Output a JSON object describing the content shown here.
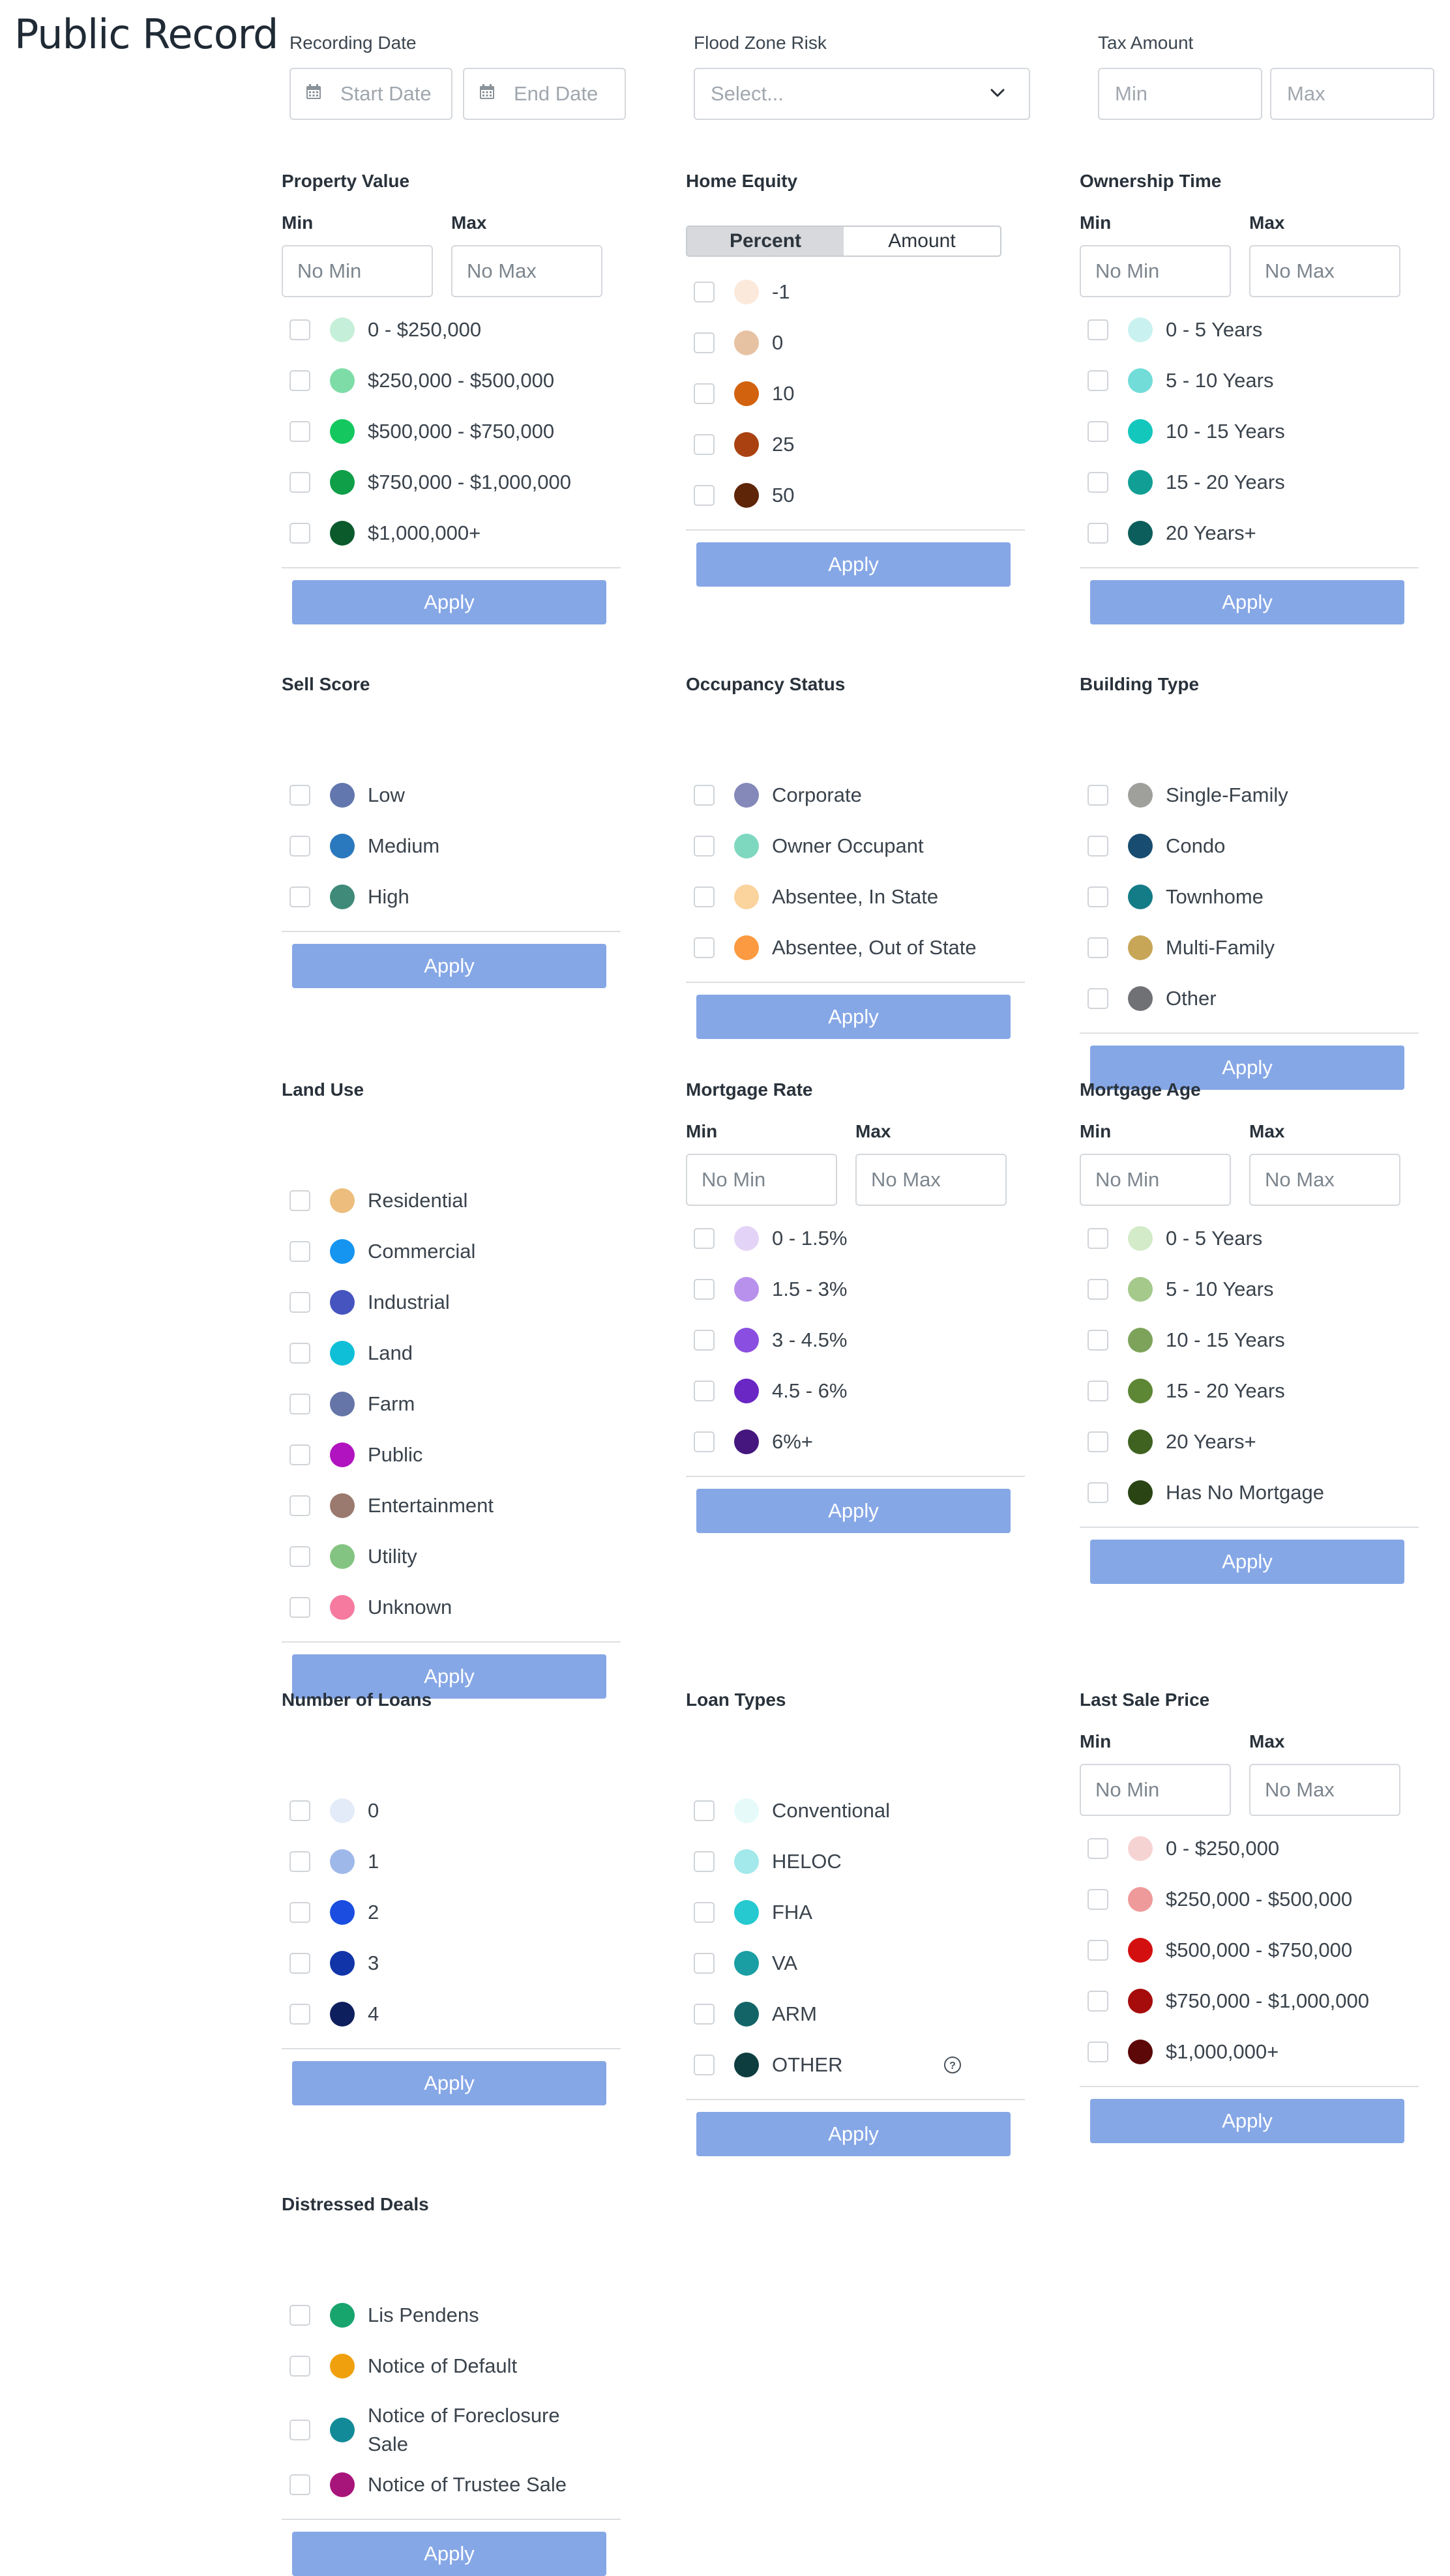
{
  "page": {
    "title": "Public Record"
  },
  "top_filters": {
    "recording_date": {
      "label": "Recording Date",
      "start_placeholder": "Start Date",
      "end_placeholder": "End Date"
    },
    "flood_zone": {
      "label": "Flood Zone Risk",
      "placeholder": "Select..."
    },
    "tax_amount": {
      "label": "Tax Amount",
      "min_placeholder": "Min",
      "max_placeholder": "Max"
    }
  },
  "common": {
    "apply_label": "Apply",
    "min_label": "Min",
    "max_label": "Max",
    "no_min": "No Min",
    "no_max": "No Max"
  },
  "sections": {
    "property_value": {
      "title": "Property Value",
      "options": [
        {
          "label": "0 - $250,000",
          "color": "#c5efd8"
        },
        {
          "label": "$250,000 - $500,000",
          "color": "#7edca6"
        },
        {
          "label": "$500,000 - $750,000",
          "color": "#14c85f"
        },
        {
          "label": "$750,000 - $1,000,000",
          "color": "#0e9f48"
        },
        {
          "label": "$1,000,000+",
          "color": "#0a5a2c"
        }
      ]
    },
    "home_equity": {
      "title": "Home Equity",
      "toggle": {
        "percent": "Percent",
        "amount": "Amount",
        "active": "percent"
      },
      "options": [
        {
          "label": "-1",
          "color": "#fbe9dc"
        },
        {
          "label": "0",
          "color": "#e7c2a2"
        },
        {
          "label": "10",
          "color": "#d2620e"
        },
        {
          "label": "25",
          "color": "#a94210"
        },
        {
          "label": "50",
          "color": "#5e2508"
        }
      ]
    },
    "ownership_time": {
      "title": "Ownership Time",
      "options": [
        {
          "label": "0 - 5 Years",
          "color": "#c9f1f0"
        },
        {
          "label": "5 - 10 Years",
          "color": "#72dcd8"
        },
        {
          "label": "10 - 15 Years",
          "color": "#13c7bd"
        },
        {
          "label": "15 - 20 Years",
          "color": "#119f95"
        },
        {
          "label": "20 Years+",
          "color": "#0b5e5b"
        }
      ]
    },
    "sell_score": {
      "title": "Sell Score",
      "options": [
        {
          "label": "Low",
          "color": "#6277ad"
        },
        {
          "label": "Medium",
          "color": "#2a78bd"
        },
        {
          "label": "High",
          "color": "#3f8a78"
        }
      ]
    },
    "occupancy_status": {
      "title": "Occupancy Status",
      "options": [
        {
          "label": "Corporate",
          "color": "#8489b9"
        },
        {
          "label": "Owner Occupant",
          "color": "#7ed8c0"
        },
        {
          "label": "Absentee, In State",
          "color": "#fbd39d"
        },
        {
          "label": "Absentee, Out of State",
          "color": "#fb9a40"
        }
      ]
    },
    "building_type": {
      "title": "Building Type",
      "options": [
        {
          "label": "Single-Family",
          "color": "#9fa09c"
        },
        {
          "label": "Condo",
          "color": "#184c70"
        },
        {
          "label": "Townhome",
          "color": "#147c86"
        },
        {
          "label": "Multi-Family",
          "color": "#c8a657"
        },
        {
          "label": "Other",
          "color": "#6f7175"
        }
      ]
    },
    "land_use": {
      "title": "Land Use",
      "options": [
        {
          "label": "Residential",
          "color": "#ecbd7c"
        },
        {
          "label": "Commercial",
          "color": "#1594f0"
        },
        {
          "label": "Industrial",
          "color": "#4654c0"
        },
        {
          "label": "Land",
          "color": "#0fbfd8"
        },
        {
          "label": "Farm",
          "color": "#6575a8"
        },
        {
          "label": "Public",
          "color": "#b113c0"
        },
        {
          "label": "Entertainment",
          "color": "#9a7a6e"
        },
        {
          "label": "Utility",
          "color": "#84c482"
        },
        {
          "label": "Unknown",
          "color": "#f67aa0"
        }
      ]
    },
    "mortgage_rate": {
      "title": "Mortgage Rate",
      "options": [
        {
          "label": "0 - 1.5%",
          "color": "#e3d4f7"
        },
        {
          "label": "1.5 - 3%",
          "color": "#b891ec"
        },
        {
          "label": "3 - 4.5%",
          "color": "#8a4fe0"
        },
        {
          "label": "4.5 - 6%",
          "color": "#6a27c4"
        },
        {
          "label": "6%+",
          "color": "#45167e"
        }
      ]
    },
    "mortgage_age": {
      "title": "Mortgage Age",
      "options": [
        {
          "label": "0 - 5 Years",
          "color": "#d3ebc8"
        },
        {
          "label": "5 - 10 Years",
          "color": "#a4c98a"
        },
        {
          "label": "10 - 15 Years",
          "color": "#7da35b"
        },
        {
          "label": "15 - 20 Years",
          "color": "#5d8635"
        },
        {
          "label": "20 Years+",
          "color": "#3f6221"
        },
        {
          "label": "Has No Mortgage",
          "color": "#2a4414"
        }
      ]
    },
    "number_of_loans": {
      "title": "Number of Loans",
      "options": [
        {
          "label": "0",
          "color": "#e4ebf8"
        },
        {
          "label": "1",
          "color": "#9fb8ea"
        },
        {
          "label": "2",
          "color": "#1b4ee0"
        },
        {
          "label": "3",
          "color": "#1134a8"
        },
        {
          "label": "4",
          "color": "#0e1f5e"
        }
      ]
    },
    "loan_types": {
      "title": "Loan Types",
      "options": [
        {
          "label": "Conventional",
          "color": "#e6fafa"
        },
        {
          "label": "HELOC",
          "color": "#a3e8eb"
        },
        {
          "label": "FHA",
          "color": "#26c9d0"
        },
        {
          "label": "VA",
          "color": "#1a9ea3"
        },
        {
          "label": "ARM",
          "color": "#136467"
        },
        {
          "label": "OTHER",
          "color": "#0e3d3f"
        }
      ]
    },
    "last_sale_price": {
      "title": "Last Sale Price",
      "options": [
        {
          "label": "0 - $250,000",
          "color": "#f6d3d3"
        },
        {
          "label": "$250,000 - $500,000",
          "color": "#ee9a9a"
        },
        {
          "label": "$500,000 - $750,000",
          "color": "#d40f0f"
        },
        {
          "label": "$750,000 - $1,000,000",
          "color": "#a60c0c"
        },
        {
          "label": "$1,000,000+",
          "color": "#5c0808"
        }
      ]
    },
    "distressed_deals": {
      "title": "Distressed Deals",
      "options": [
        {
          "label": "Lis Pendens",
          "color": "#18a46d"
        },
        {
          "label": "Notice of Default",
          "color": "#f0a00c"
        },
        {
          "label": "Notice of Foreclosure Sale",
          "color": "#138a98"
        },
        {
          "label": "Notice of Trustee Sale",
          "color": "#a8157a"
        }
      ]
    }
  }
}
